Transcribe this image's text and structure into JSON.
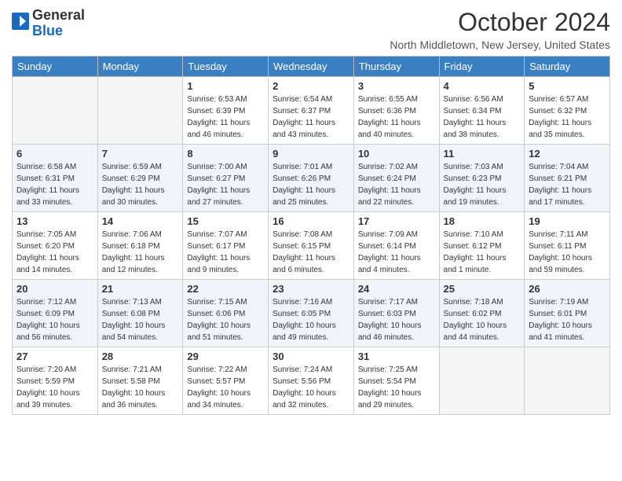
{
  "header": {
    "logo_general": "General",
    "logo_blue": "Blue",
    "title": "October 2024",
    "location": "North Middletown, New Jersey, United States"
  },
  "weekdays": [
    "Sunday",
    "Monday",
    "Tuesday",
    "Wednesday",
    "Thursday",
    "Friday",
    "Saturday"
  ],
  "weeks": [
    [
      {
        "day": "",
        "info": ""
      },
      {
        "day": "",
        "info": ""
      },
      {
        "day": "1",
        "info": "Sunrise: 6:53 AM\nSunset: 6:39 PM\nDaylight: 11 hours and 46 minutes."
      },
      {
        "day": "2",
        "info": "Sunrise: 6:54 AM\nSunset: 6:37 PM\nDaylight: 11 hours and 43 minutes."
      },
      {
        "day": "3",
        "info": "Sunrise: 6:55 AM\nSunset: 6:36 PM\nDaylight: 11 hours and 40 minutes."
      },
      {
        "day": "4",
        "info": "Sunrise: 6:56 AM\nSunset: 6:34 PM\nDaylight: 11 hours and 38 minutes."
      },
      {
        "day": "5",
        "info": "Sunrise: 6:57 AM\nSunset: 6:32 PM\nDaylight: 11 hours and 35 minutes."
      }
    ],
    [
      {
        "day": "6",
        "info": "Sunrise: 6:58 AM\nSunset: 6:31 PM\nDaylight: 11 hours and 33 minutes."
      },
      {
        "day": "7",
        "info": "Sunrise: 6:59 AM\nSunset: 6:29 PM\nDaylight: 11 hours and 30 minutes."
      },
      {
        "day": "8",
        "info": "Sunrise: 7:00 AM\nSunset: 6:27 PM\nDaylight: 11 hours and 27 minutes."
      },
      {
        "day": "9",
        "info": "Sunrise: 7:01 AM\nSunset: 6:26 PM\nDaylight: 11 hours and 25 minutes."
      },
      {
        "day": "10",
        "info": "Sunrise: 7:02 AM\nSunset: 6:24 PM\nDaylight: 11 hours and 22 minutes."
      },
      {
        "day": "11",
        "info": "Sunrise: 7:03 AM\nSunset: 6:23 PM\nDaylight: 11 hours and 19 minutes."
      },
      {
        "day": "12",
        "info": "Sunrise: 7:04 AM\nSunset: 6:21 PM\nDaylight: 11 hours and 17 minutes."
      }
    ],
    [
      {
        "day": "13",
        "info": "Sunrise: 7:05 AM\nSunset: 6:20 PM\nDaylight: 11 hours and 14 minutes."
      },
      {
        "day": "14",
        "info": "Sunrise: 7:06 AM\nSunset: 6:18 PM\nDaylight: 11 hours and 12 minutes."
      },
      {
        "day": "15",
        "info": "Sunrise: 7:07 AM\nSunset: 6:17 PM\nDaylight: 11 hours and 9 minutes."
      },
      {
        "day": "16",
        "info": "Sunrise: 7:08 AM\nSunset: 6:15 PM\nDaylight: 11 hours and 6 minutes."
      },
      {
        "day": "17",
        "info": "Sunrise: 7:09 AM\nSunset: 6:14 PM\nDaylight: 11 hours and 4 minutes."
      },
      {
        "day": "18",
        "info": "Sunrise: 7:10 AM\nSunset: 6:12 PM\nDaylight: 11 hours and 1 minute."
      },
      {
        "day": "19",
        "info": "Sunrise: 7:11 AM\nSunset: 6:11 PM\nDaylight: 10 hours and 59 minutes."
      }
    ],
    [
      {
        "day": "20",
        "info": "Sunrise: 7:12 AM\nSunset: 6:09 PM\nDaylight: 10 hours and 56 minutes."
      },
      {
        "day": "21",
        "info": "Sunrise: 7:13 AM\nSunset: 6:08 PM\nDaylight: 10 hours and 54 minutes."
      },
      {
        "day": "22",
        "info": "Sunrise: 7:15 AM\nSunset: 6:06 PM\nDaylight: 10 hours and 51 minutes."
      },
      {
        "day": "23",
        "info": "Sunrise: 7:16 AM\nSunset: 6:05 PM\nDaylight: 10 hours and 49 minutes."
      },
      {
        "day": "24",
        "info": "Sunrise: 7:17 AM\nSunset: 6:03 PM\nDaylight: 10 hours and 46 minutes."
      },
      {
        "day": "25",
        "info": "Sunrise: 7:18 AM\nSunset: 6:02 PM\nDaylight: 10 hours and 44 minutes."
      },
      {
        "day": "26",
        "info": "Sunrise: 7:19 AM\nSunset: 6:01 PM\nDaylight: 10 hours and 41 minutes."
      }
    ],
    [
      {
        "day": "27",
        "info": "Sunrise: 7:20 AM\nSunset: 5:59 PM\nDaylight: 10 hours and 39 minutes."
      },
      {
        "day": "28",
        "info": "Sunrise: 7:21 AM\nSunset: 5:58 PM\nDaylight: 10 hours and 36 minutes."
      },
      {
        "day": "29",
        "info": "Sunrise: 7:22 AM\nSunset: 5:57 PM\nDaylight: 10 hours and 34 minutes."
      },
      {
        "day": "30",
        "info": "Sunrise: 7:24 AM\nSunset: 5:56 PM\nDaylight: 10 hours and 32 minutes."
      },
      {
        "day": "31",
        "info": "Sunrise: 7:25 AM\nSunset: 5:54 PM\nDaylight: 10 hours and 29 minutes."
      },
      {
        "day": "",
        "info": ""
      },
      {
        "day": "",
        "info": ""
      }
    ]
  ]
}
